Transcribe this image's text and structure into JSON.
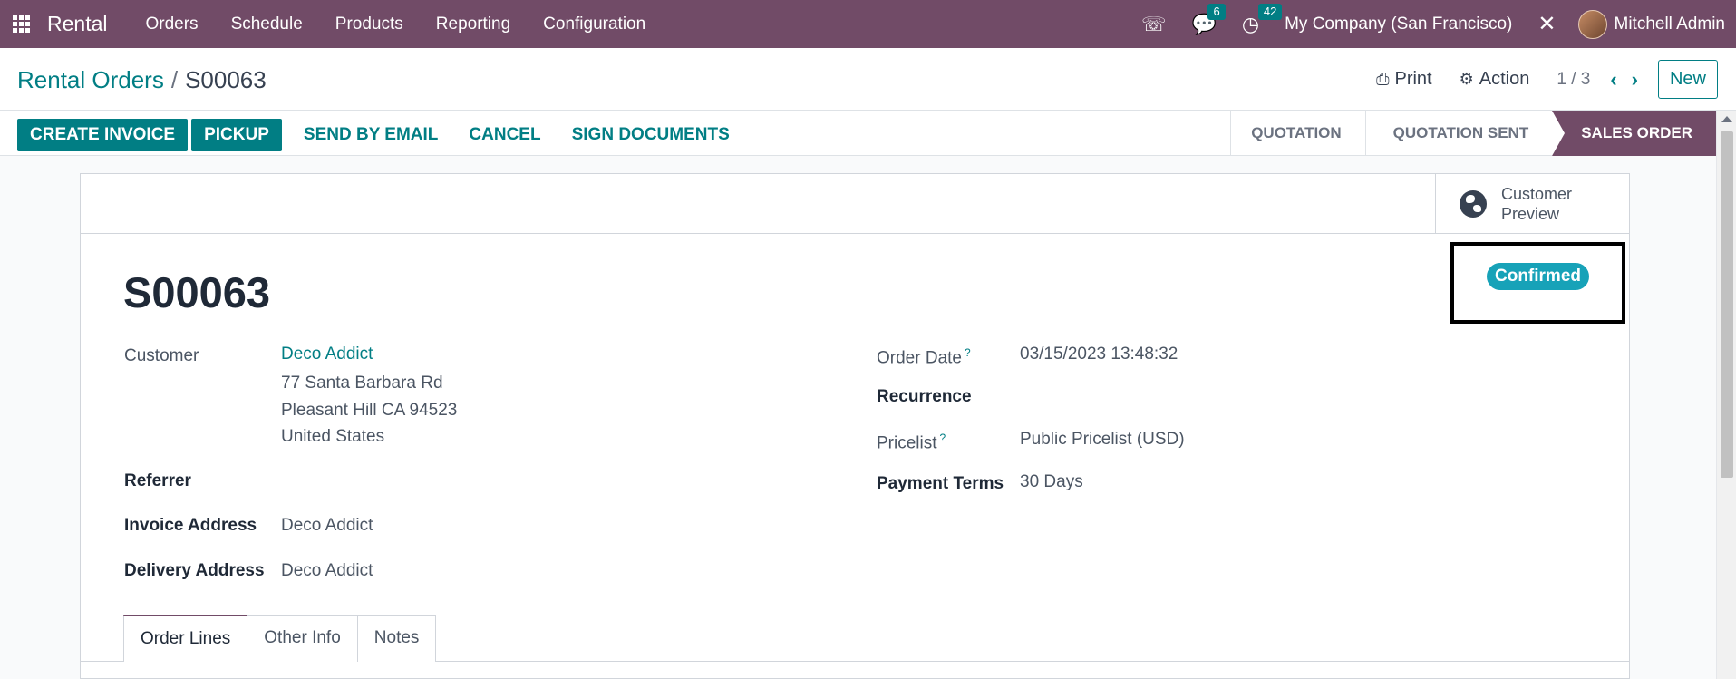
{
  "navbar": {
    "app_name": "Rental",
    "menu": [
      "Orders",
      "Schedule",
      "Products",
      "Reporting",
      "Configuration"
    ],
    "messages_count": "6",
    "activities_count": "42",
    "company": "My Company (San Francisco)",
    "user": "Mitchell Admin"
  },
  "breadcrumb": {
    "parent": "Rental Orders",
    "separator": "/",
    "current": "S00063"
  },
  "control_panel": {
    "print_label": "Print",
    "action_label": "Action",
    "pager": "1 / 3",
    "new_label": "New"
  },
  "statusbar": {
    "buttons": {
      "create_invoice": "CREATE INVOICE",
      "pickup": "PICKUP",
      "send_by_email": "SEND BY EMAIL",
      "cancel": "CANCEL",
      "sign_documents": "SIGN DOCUMENTS"
    },
    "stages": [
      "QUOTATION",
      "QUOTATION SENT",
      "SALES ORDER"
    ],
    "active_stage": "SALES ORDER"
  },
  "sheet": {
    "customer_preview": "Customer Preview",
    "status_badge": "Confirmed",
    "record_name": "S00063",
    "customer_label": "Customer",
    "customer_name": "Deco Addict",
    "customer_address": [
      "77 Santa Barbara Rd",
      "Pleasant Hill CA 94523",
      "United States"
    ],
    "referrer_label": "Referrer",
    "invoice_address_label": "Invoice Address",
    "invoice_address": "Deco Addict",
    "delivery_address_label": "Delivery Address",
    "delivery_address": "Deco Addict",
    "order_date_label": "Order Date",
    "order_date": "03/15/2023 13:48:32",
    "recurrence_label": "Recurrence",
    "pricelist_label": "Pricelist",
    "pricelist": "Public Pricelist (USD)",
    "payment_terms_label": "Payment Terms",
    "payment_terms": "30 Days",
    "help_mark": "?",
    "tabs": [
      "Order Lines",
      "Other Info",
      "Notes"
    ],
    "active_tab": "Order Lines"
  },
  "colors": {
    "brand": "#714B67",
    "accent": "#017e84",
    "badge": "#17a2b8"
  }
}
